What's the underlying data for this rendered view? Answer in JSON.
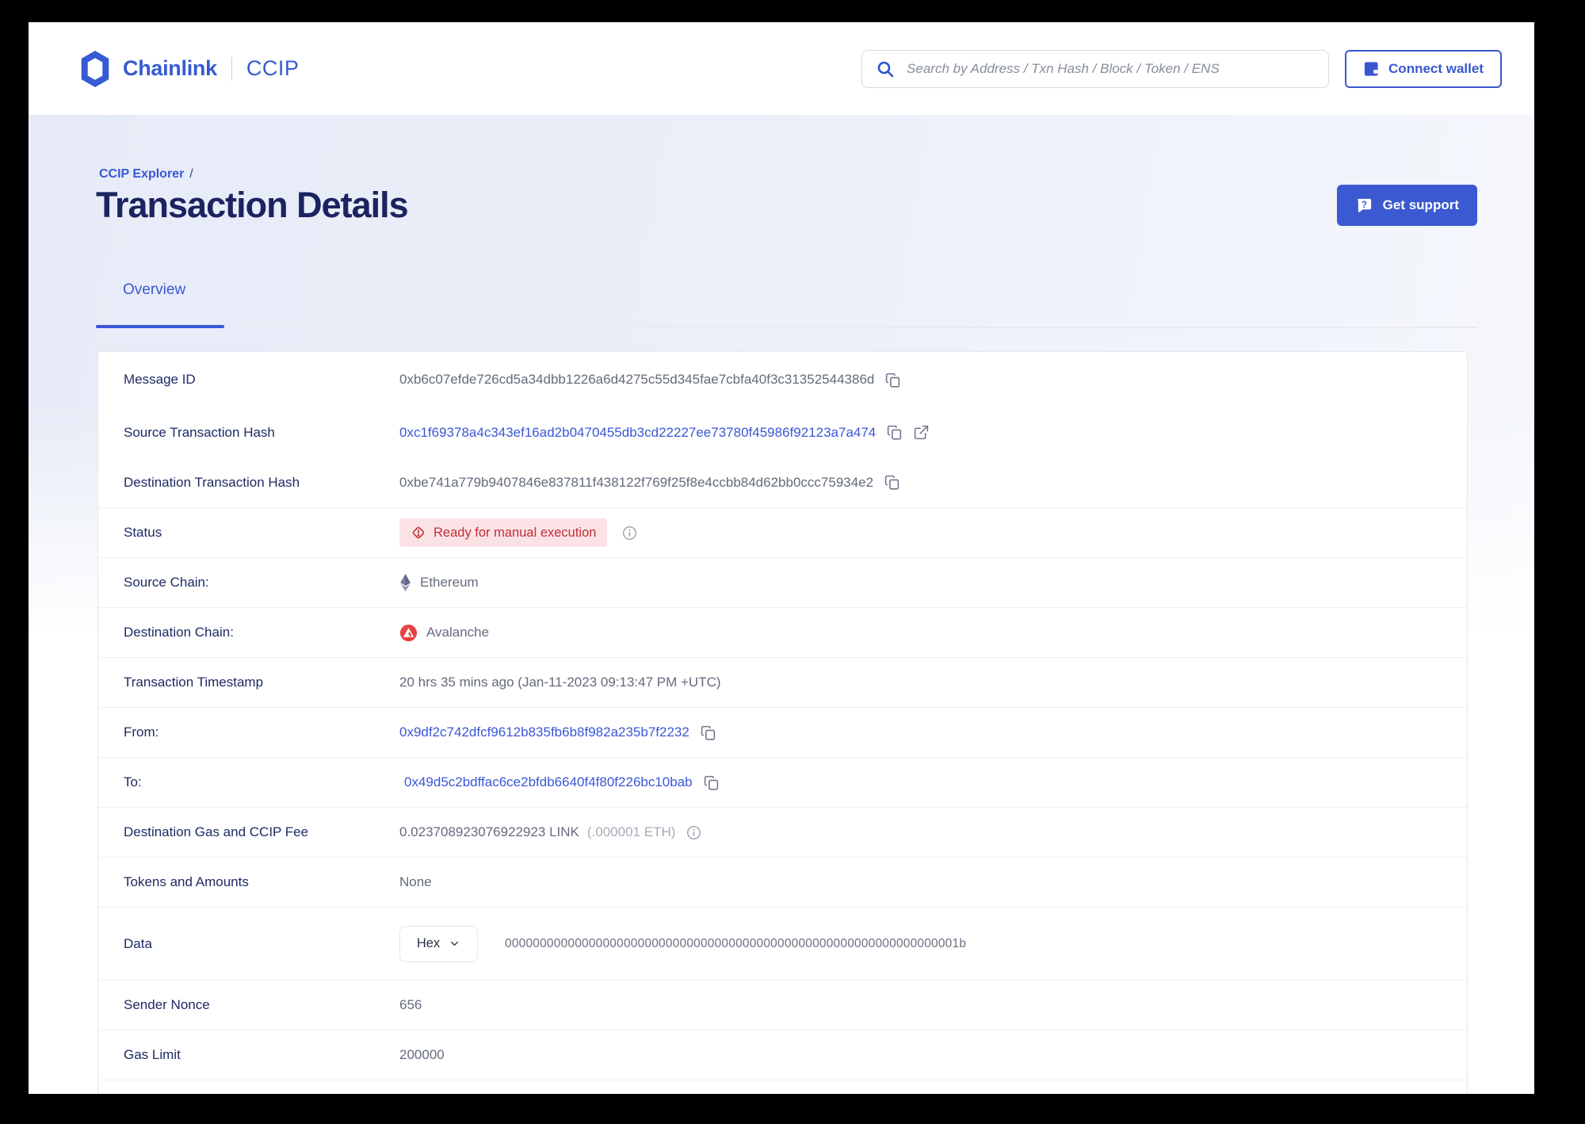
{
  "header": {
    "brand": "Chainlink",
    "product": "CCIP",
    "search": {
      "placeholder": "Search by Address / Txn Hash / Block / Token / ENS"
    },
    "connect_wallet_label": "Connect wallet"
  },
  "breadcrumb": {
    "parent": "CCIP Explorer",
    "separator": "/"
  },
  "page_header": {
    "title": "Transaction Details",
    "get_support_label": "Get support"
  },
  "tabs": [
    {
      "label": "Overview",
      "active": true
    }
  ],
  "transaction": {
    "rows": {
      "message_id": {
        "label": "Message ID",
        "value": "0xb6c07efde726cd5a34dbb1226a6d4275c55d345fae7cbfa40f3c31352544386d"
      },
      "source_tx": {
        "label": "Source Transaction Hash",
        "value": "0xc1f69378a4c343ef16ad2b0470455db3cd22227ee73780f45986f92123a7a474"
      },
      "dest_tx": {
        "label": "Destination Transaction Hash",
        "value": "0xbe741a779b9407846e837811f438122f769f25f8e4ccbb84d62bb0ccc75934e2"
      },
      "status": {
        "label": "Status",
        "value": "Ready for manual execution"
      },
      "source_chain": {
        "label": "Source Chain:",
        "value": "Ethereum"
      },
      "dest_chain": {
        "label": "Destination Chain:",
        "value": "Avalanche"
      },
      "timestamp": {
        "label": "Transaction Timestamp",
        "value": "20 hrs 35 mins ago (Jan-11-2023 09:13:47 PM +UTC)"
      },
      "from": {
        "label": "From:",
        "value": "0x9df2c742dfcf9612b835fb6b8f982a235b7f2232"
      },
      "to": {
        "label": "To:",
        "value": "0x49d5c2bdffac6ce2bfdb6640f4f80f226bc10bab"
      },
      "fee": {
        "label": "Destination Gas and CCIP Fee",
        "value": "0.023708923076922923 LINK",
        "secondary": "(.000001 ETH)"
      },
      "tokens": {
        "label": "Tokens and Amounts",
        "value": "None"
      },
      "data": {
        "label": "Data",
        "format": "Hex",
        "value": "00000000000000000000000000000000000000000000000000000000000000001b"
      },
      "sender_nonce": {
        "label": "Sender Nonce",
        "value": "656"
      },
      "gas_limit": {
        "label": "Gas Limit",
        "value": "200000"
      }
    }
  },
  "icons": {
    "chainlink_logo": "chainlink-hexagon-icon",
    "search": "search-icon",
    "wallet": "wallet-icon",
    "support": "question-bubble-icon",
    "copy": "copy-icon",
    "external": "external-link-icon",
    "status_alert": "alert-diamond-icon",
    "info": "info-icon",
    "ethereum": "ethereum-icon",
    "avalanche": "avalanche-icon",
    "chevron": "chevron-down-icon"
  },
  "colors": {
    "brand_blue": "#375bd2",
    "link_blue": "#3a57d7",
    "title_navy": "#1b2361",
    "label_navy": "#1e2a63",
    "value_gray": "#646b7b",
    "muted_gray": "#a6abb7",
    "status_red": "#c32d35",
    "status_bg": "#fbe3e5",
    "avalanche_red": "#e84142",
    "hero_tint": "#e7ecf8",
    "divider": "#edeff4"
  }
}
